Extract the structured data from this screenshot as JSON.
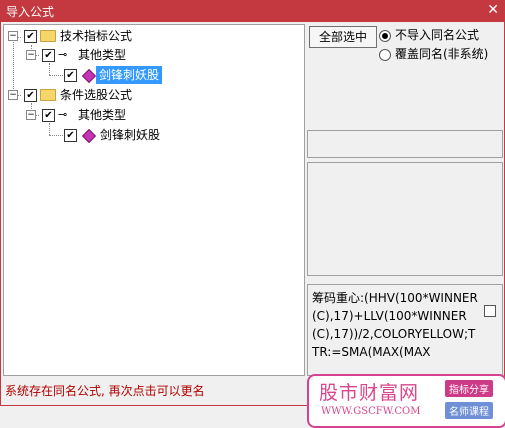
{
  "window": {
    "title": "导入公式",
    "close_glyph": "✕"
  },
  "tree": {
    "items": [
      {
        "label": "技术指标公式",
        "checked": true
      },
      {
        "label": "其他类型",
        "checked": true
      },
      {
        "label": "剑锋刺妖股",
        "checked": true,
        "selected": true
      },
      {
        "label": "条件选股公式",
        "checked": true
      },
      {
        "label": "其他类型",
        "checked": true
      },
      {
        "label": "剑锋刺妖股",
        "checked": true
      }
    ]
  },
  "options": {
    "select_all_label": "全部选中",
    "radio_no_import": "不导入同名公式",
    "radio_overwrite": "覆盖同名(非系统)"
  },
  "code_preview": "筹码重心:(HHV(100*WINNER(C),17)+LLV(100*WINNER(C),17))/2,COLORYELLOW;TTR:=SMA(MAX(MAX",
  "status_text": "系统存在同名公式, 再次点击可以更名",
  "watermark": {
    "logo": "股市财富网",
    "url": "WWW.GSCFW.COM",
    "tag1": "指标分享",
    "tag2": "名师课程"
  },
  "colors": {
    "title_bar": "#c4383f",
    "selection": "#3399ff",
    "status": "#b00000",
    "watermark_pink": "#d9468c"
  }
}
